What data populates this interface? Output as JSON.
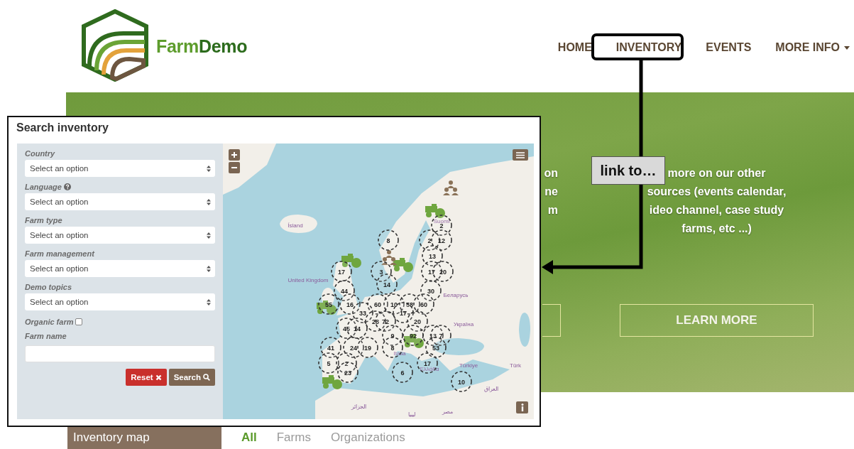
{
  "header": {
    "brand": [
      "Farm",
      "Demo"
    ],
    "nav": [
      {
        "label": "HOME",
        "has_menu": false
      },
      {
        "label": "INVENTORY",
        "has_menu": false
      },
      {
        "label": "EVENTS",
        "has_menu": false
      },
      {
        "label": "MORE INFO",
        "has_menu": true
      }
    ]
  },
  "hero": {
    "left_text": [
      "on",
      "ne",
      "m"
    ],
    "right_text": [
      "more on our other",
      "sources (events calendar,",
      "ideo channel, case study",
      "farms, etc ...)"
    ],
    "button": "LEARN MORE"
  },
  "annotation": {
    "label": "link to…"
  },
  "search_panel": {
    "title": "Search inventory",
    "filters": [
      {
        "kind": "select",
        "label": "Country",
        "help": false,
        "value": "Select an option"
      },
      {
        "kind": "select",
        "label": "Language",
        "help": true,
        "value": "Select an option"
      },
      {
        "kind": "select",
        "label": "Farm type",
        "help": false,
        "value": "Select an option"
      },
      {
        "kind": "select",
        "label": "Farm management",
        "help": false,
        "value": "Select an option"
      },
      {
        "kind": "select",
        "label": "Demo topics",
        "help": false,
        "value": "Select an option"
      },
      {
        "kind": "checkbox",
        "label": "Organic farm",
        "checked": false
      },
      {
        "kind": "text",
        "label": "Farm name"
      }
    ],
    "buttons": [
      {
        "kind": "reset",
        "label": "Reset"
      },
      {
        "kind": "search",
        "label": "Search"
      }
    ]
  },
  "map": {
    "place_labels": [
      "Ísland",
      "Suomi",
      "United Kingdom",
      "Беларусь",
      "Україна",
      "Italia",
      "Ελλάδα",
      "Türkiye",
      "Türk",
      "العراق",
      "الجزائر",
      "ليبيا",
      "مصر"
    ],
    "clusters": [
      {
        "label": "2"
      },
      {
        "label": "8"
      },
      {
        "label": "2"
      },
      {
        "label": "12"
      },
      {
        "label": "13"
      },
      {
        "label": "17"
      },
      {
        "label": "3"
      },
      {
        "label": "17"
      },
      {
        "label": "20"
      },
      {
        "label": "14"
      },
      {
        "label": "44"
      },
      {
        "label": "30"
      },
      {
        "label": "55"
      },
      {
        "label": "16"
      },
      {
        "label": "60"
      },
      {
        "label": "10"
      },
      {
        "label": "58"
      },
      {
        "label": "60"
      },
      {
        "label": "33"
      },
      {
        "label": "17"
      },
      {
        "label": "28"
      },
      {
        "label": "72"
      },
      {
        "label": "20"
      },
      {
        "label": "45"
      },
      {
        "label": "14"
      },
      {
        "label": "9"
      },
      {
        "label": "92"
      },
      {
        "label": "13"
      },
      {
        "label": "7"
      },
      {
        "label": "41"
      },
      {
        "label": "24"
      },
      {
        "label": "19"
      },
      {
        "label": "8"
      },
      {
        "label": "53"
      },
      {
        "label": "5"
      },
      {
        "label": "2"
      },
      {
        "label": "17"
      },
      {
        "label": "23"
      },
      {
        "label": "6"
      },
      {
        "label": "10"
      }
    ],
    "markers": [
      {
        "kind": "farm"
      },
      {
        "kind": "farm"
      },
      {
        "kind": "farm"
      },
      {
        "kind": "farm"
      },
      {
        "kind": "farm"
      },
      {
        "kind": "farm"
      },
      {
        "kind": "organization"
      },
      {
        "kind": "organization"
      }
    ]
  },
  "tabs": {
    "title": "Inventory map",
    "items": [
      {
        "label": "All",
        "selected": true
      },
      {
        "label": "Farms",
        "selected": false
      },
      {
        "label": "Organizations",
        "selected": false
      }
    ]
  }
}
